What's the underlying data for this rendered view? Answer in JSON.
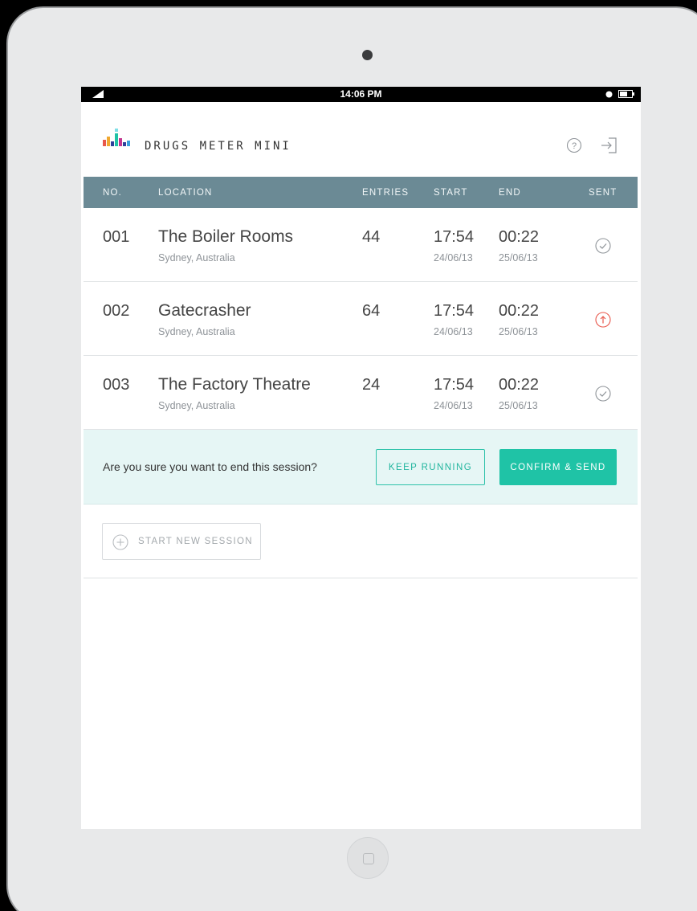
{
  "status_bar": {
    "time": "14:06 PM"
  },
  "app": {
    "title": "DRUGS METER MINI"
  },
  "table": {
    "columns": {
      "no": "NO.",
      "location": "LOCATION",
      "entries": "ENTRIES",
      "start": "START",
      "end": "END",
      "sent": "SENT"
    },
    "rows": [
      {
        "no": "001",
        "location": "The Boiler Rooms",
        "city": "Sydney, Australia",
        "entries": "44",
        "start_time": "17:54",
        "start_date": "24/06/13",
        "end_time": "00:22",
        "end_date": "25/06/13",
        "sent_status": "sent",
        "sent_icon": "check-circle-icon"
      },
      {
        "no": "002",
        "location": "Gatecrasher",
        "city": "Sydney, Australia",
        "entries": "64",
        "start_time": "17:54",
        "start_date": "24/06/13",
        "end_time": "00:22",
        "end_date": "25/06/13",
        "sent_status": "pending",
        "sent_icon": "upload-circle-icon"
      },
      {
        "no": "003",
        "location": "The Factory Theatre",
        "city": "Sydney, Australia",
        "entries": "24",
        "start_time": "17:54",
        "start_date": "24/06/13",
        "end_time": "00:22",
        "end_date": "25/06/13",
        "sent_status": "sent",
        "sent_icon": "check-circle-icon"
      }
    ]
  },
  "confirm": {
    "message": "Are you sure you want to end this session?",
    "keep_label": "KEEP RUNNING",
    "send_label": "CONFIRM & SEND"
  },
  "start_session": {
    "label": "START NEW SESSION"
  },
  "colors": {
    "header_bg": "#6b8a95",
    "accent": "#1fc3a6",
    "confirm_bg": "#e6f6f5",
    "alert": "#e8574b",
    "sent_icon": "#8f9499"
  }
}
